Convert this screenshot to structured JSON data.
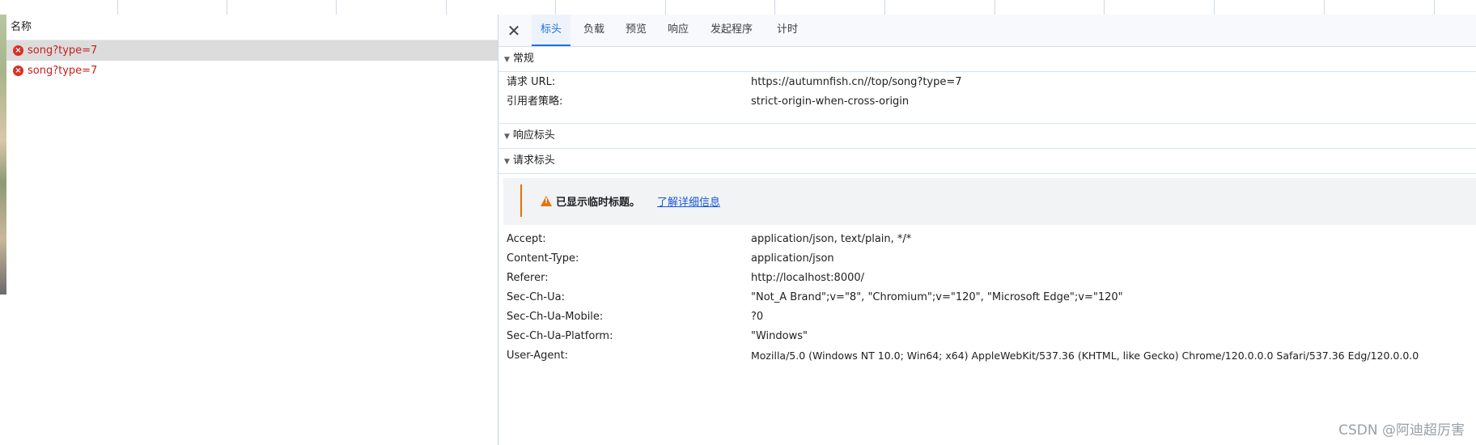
{
  "left_panel": {
    "header": "名称",
    "requests": [
      {
        "name": "song?type=7",
        "status": "error"
      },
      {
        "name": "song?type=7",
        "status": "error"
      }
    ]
  },
  "tabs": [
    {
      "label": "标头",
      "active": true
    },
    {
      "label": "负载",
      "active": false
    },
    {
      "label": "预览",
      "active": false
    },
    {
      "label": "响应",
      "active": false
    },
    {
      "label": "发起程序",
      "active": false
    },
    {
      "label": "计时",
      "active": false
    }
  ],
  "close_icon": "close-icon",
  "general": {
    "title": "常规",
    "rows": [
      {
        "key": "请求 URL:",
        "value": "https://autumnfish.cn//top/song?type=7"
      },
      {
        "key": "引用者策略:",
        "value": "strict-origin-when-cross-origin"
      }
    ]
  },
  "response_headers": {
    "title": "响应标头"
  },
  "request_headers": {
    "title": "请求标头",
    "warning": {
      "icon": "warning-icon",
      "text": "已显示临时标题。",
      "link": "了解详细信息"
    },
    "rows": [
      {
        "key": "Accept:",
        "value": "application/json, text/plain, */*"
      },
      {
        "key": "Content-Type:",
        "value": "application/json"
      },
      {
        "key": "Referer:",
        "value": "http://localhost:8000/"
      },
      {
        "key": "Sec-Ch-Ua:",
        "value": "\"Not_A Brand\";v=\"8\", \"Chromium\";v=\"120\", \"Microsoft Edge\";v=\"120\""
      },
      {
        "key": "Sec-Ch-Ua-Mobile:",
        "value": "?0"
      },
      {
        "key": "Sec-Ch-Ua-Platform:",
        "value": "\"Windows\""
      },
      {
        "key": "User-Agent:",
        "value": "Mozilla/5.0 (Windows NT 10.0; Win64; x64) AppleWebKit/537.36 (KHTML, like Gecko) Chrome/120.0.0.0 Safari/537.36 Edg/120.0.0.0"
      }
    ]
  },
  "watermark": "CSDN @阿迪超厉害",
  "colors": {
    "accent": "#1a73e8",
    "error": "#d93025",
    "warning": "#e8710a"
  }
}
